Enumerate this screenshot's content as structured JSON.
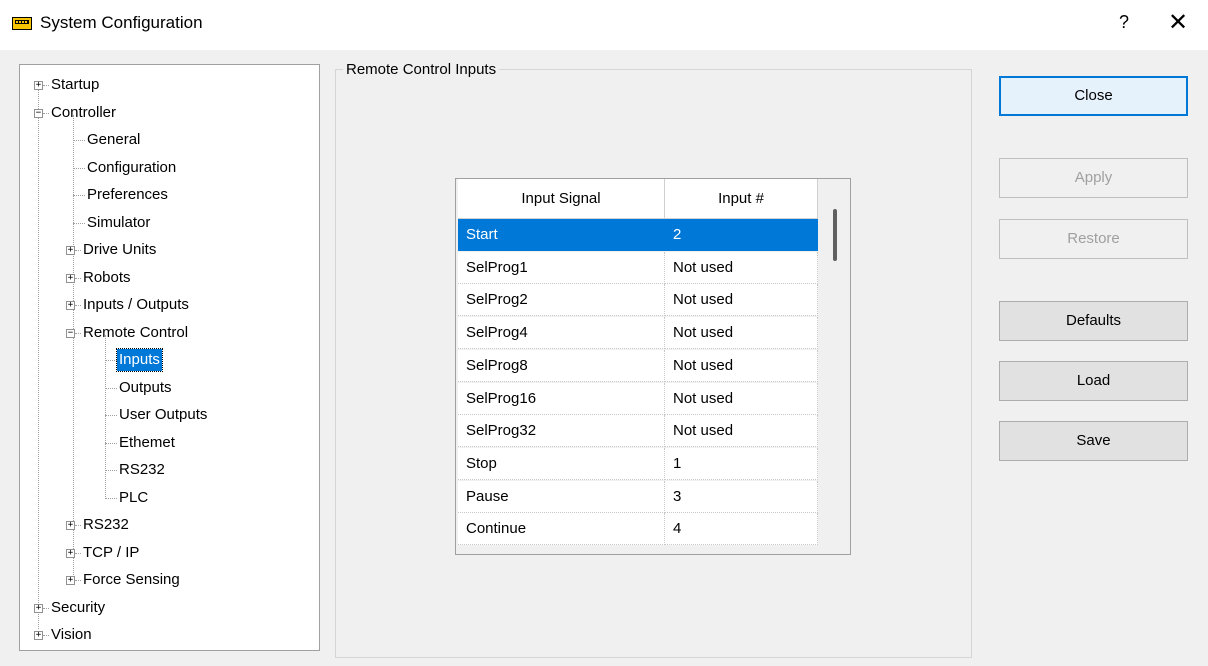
{
  "window": {
    "title": "System Configuration",
    "help_label": "?",
    "close_label": "✕"
  },
  "tree": {
    "expander_plus": "+",
    "expander_minus": "−",
    "nodes": [
      {
        "label": "Startup",
        "expander": "+"
      },
      {
        "label": "Controller",
        "expander": "−"
      },
      {
        "label": "General"
      },
      {
        "label": "Configuration"
      },
      {
        "label": "Preferences"
      },
      {
        "label": "Simulator"
      },
      {
        "label": "Drive Units",
        "expander": "+"
      },
      {
        "label": "Robots",
        "expander": "+"
      },
      {
        "label": "Inputs / Outputs",
        "expander": "+"
      },
      {
        "label": "Remote Control",
        "expander": "−"
      },
      {
        "label": "Inputs",
        "selected": true
      },
      {
        "label": "Outputs"
      },
      {
        "label": "User Outputs"
      },
      {
        "label": "Ethemet"
      },
      {
        "label": "RS232"
      },
      {
        "label": "PLC"
      },
      {
        "label": "RS232",
        "expander": "+"
      },
      {
        "label": "TCP / IP",
        "expander": "+"
      },
      {
        "label": "Force Sensing",
        "expander": "+"
      },
      {
        "label": "Security",
        "expander": "+"
      },
      {
        "label": "Vision",
        "expander": "+"
      }
    ]
  },
  "group": {
    "title": "Remote Control Inputs"
  },
  "grid": {
    "columns": [
      "Input Signal",
      "Input #"
    ],
    "rows": [
      {
        "signal": "Start",
        "input": "2",
        "selected": true
      },
      {
        "signal": "SelProg1",
        "input": "Not used"
      },
      {
        "signal": "SelProg2",
        "input": "Not used"
      },
      {
        "signal": "SelProg4",
        "input": "Not used"
      },
      {
        "signal": "SelProg8",
        "input": "Not used"
      },
      {
        "signal": "SelProg16",
        "input": "Not used"
      },
      {
        "signal": "SelProg32",
        "input": "Not used"
      },
      {
        "signal": "Stop",
        "input": "1"
      },
      {
        "signal": "Pause",
        "input": "3"
      },
      {
        "signal": "Continue",
        "input": "4"
      }
    ]
  },
  "buttons": {
    "close": "Close",
    "apply": "Apply",
    "restore": "Restore",
    "defaults": "Defaults",
    "load": "Load",
    "save": "Save"
  },
  "colors": {
    "selection": "#0078d7",
    "app_icon": "#f5c400"
  }
}
